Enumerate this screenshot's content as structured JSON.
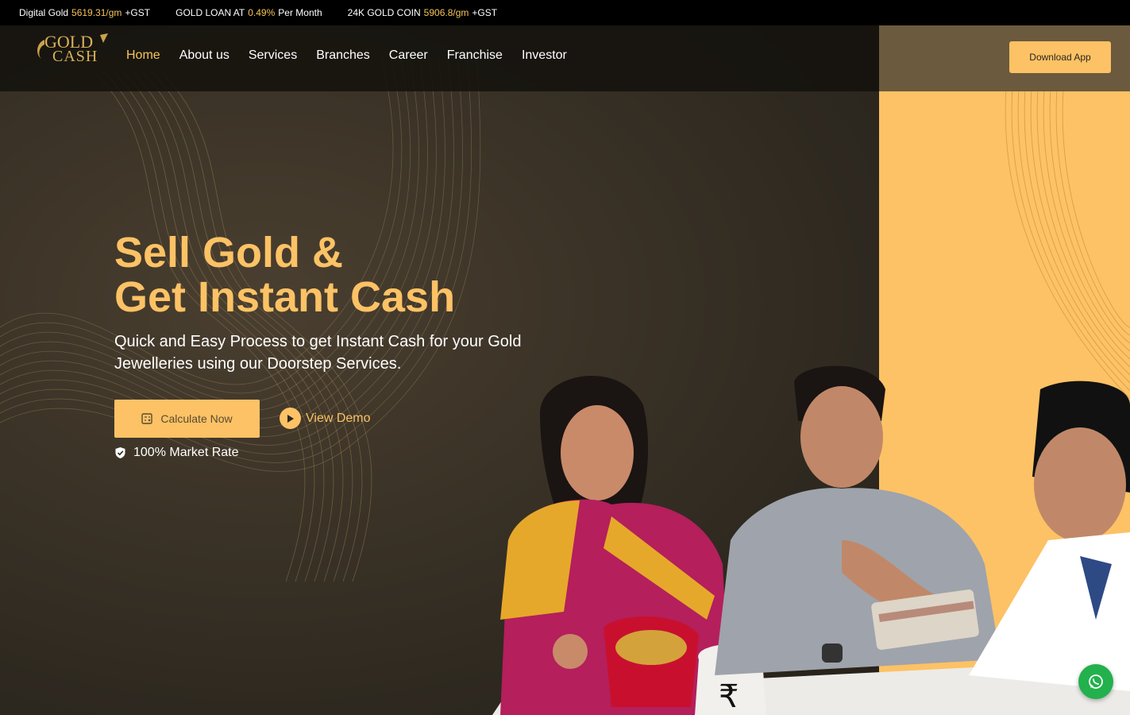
{
  "ticker": [
    {
      "label": "Digital Gold",
      "value": "5619.31/gm",
      "suffix": "+GST"
    },
    {
      "label": "GOLD LOAN AT",
      "value": "0.49%",
      "suffix": "Per Month"
    },
    {
      "label": "24K GOLD COIN",
      "value": "5906.8/gm",
      "suffix": "+GST"
    }
  ],
  "logo": {
    "line1": "GOLD",
    "line2": "CASH"
  },
  "nav": {
    "items": [
      "Home",
      "About us",
      "Services",
      "Branches",
      "Career",
      "Franchise",
      "Investor"
    ],
    "active": "Home",
    "download_label": "Download App"
  },
  "hero": {
    "title_line1": "Sell Gold &",
    "title_line2": "Get Instant Cash",
    "subtitle": "Quick and Easy Process to get Instant Cash for your Gold Jewelleries using our Doorstep Services.",
    "calculate_label": "Calculate Now",
    "demo_label": "View Demo",
    "market_label": "100% Market Rate",
    "rupee_symbol": "₹"
  },
  "colors": {
    "accent": "#fcc265",
    "ticker_bg": "#000000",
    "hero_dark": "#2c271f",
    "whatsapp": "#22b14c"
  },
  "icons": {
    "calculator": "calculator-icon",
    "play": "play-icon",
    "shield": "shield-check-icon",
    "whatsapp": "whatsapp-icon"
  }
}
